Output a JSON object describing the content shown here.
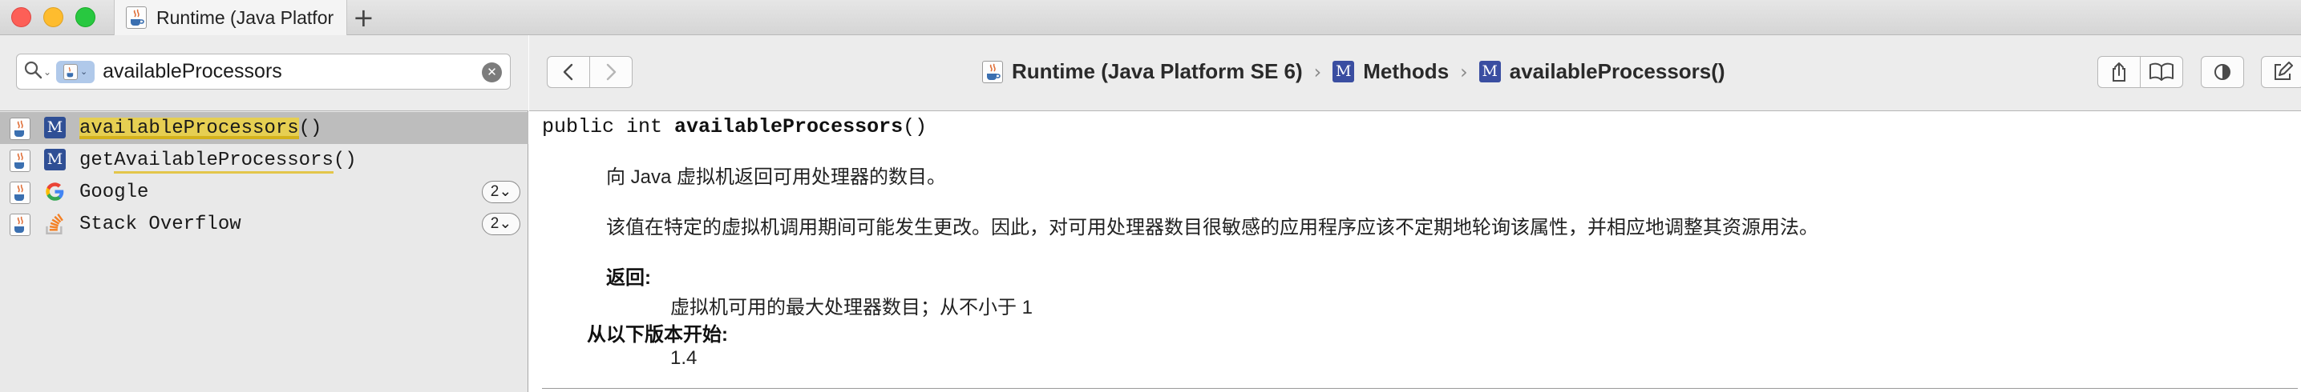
{
  "window": {
    "tab_title": "Runtime (Java Platfor",
    "new_tab_symbol": "+"
  },
  "search": {
    "value": "availableProcessors",
    "placeholder": ""
  },
  "results": [
    {
      "pre": "",
      "match": "availableProcessors",
      "post": "()",
      "kind": "M",
      "badge": ""
    },
    {
      "pre": "get",
      "match": "AvailableProcessors",
      "post": "()",
      "kind": "M",
      "badge": ""
    },
    {
      "pre": "Google",
      "match": "",
      "post": "",
      "kind": "G",
      "badge": "2⌄"
    },
    {
      "pre": "Stack Overflow",
      "match": "",
      "post": "",
      "kind": "SO",
      "badge": "2⌄"
    }
  ],
  "breadcrumb": {
    "item1": "Runtime (Java Platform SE 6)",
    "item2": "Methods",
    "item3": "availableProcessors()",
    "sep": "›",
    "kind_letter": "M"
  },
  "doc": {
    "sig_prefix": "public int ",
    "sig_name": "availableProcessors",
    "sig_suffix": "()",
    "desc1": "向 Java 虚拟机返回可用处理器的数目。",
    "desc2": "该值在特定的虚拟机调用期间可能发生更改。因此，对可用处理器数目很敏感的应用程序应该不定期地轮询该属性，并相应地调整其资源用法。",
    "returns_label": "返回:",
    "returns_value": "虚拟机可用的最大处理器数目；从不小于 1",
    "since_label": "从以下版本开始:",
    "since_value": "1.4"
  },
  "icons": {
    "app": "java-coffee-icon",
    "method": "method-m-icon",
    "google": "google-g-icon",
    "stackoverflow": "stackoverflow-icon"
  },
  "colors": {
    "method_badge": "#2f4f95",
    "highlight": "#e6cf52",
    "selection": "#bdbdbd"
  }
}
